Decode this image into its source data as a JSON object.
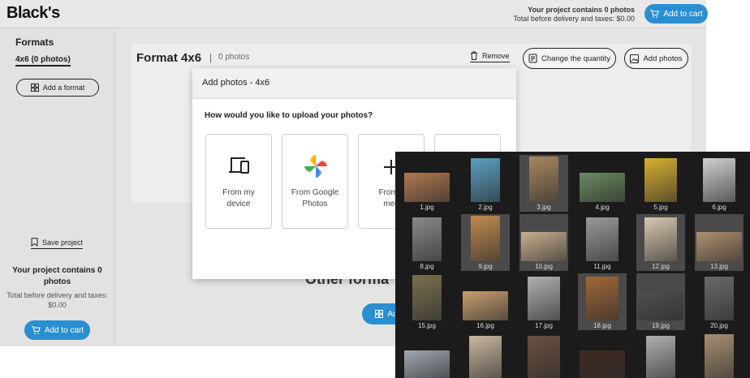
{
  "header": {
    "logo": "Black's",
    "project_summary": "Your project contains 0 photos",
    "total_note": "Total before delivery and taxes: $0.00",
    "add_to_cart": "Add to cart"
  },
  "sidebar": {
    "title": "Formats",
    "selected_format": "4x6 (0 photos)",
    "add_format": "Add a format",
    "save_project": "Save project",
    "summary_title": "Your project contains 0 photos",
    "summary_note": "Total before delivery and taxes: $0.00",
    "add_to_cart": "Add to cart"
  },
  "main": {
    "format_title": "Format 4x6",
    "separator": "|",
    "photo_count": "0 photos",
    "remove": "Remove",
    "change_quantity": "Change the quantity",
    "add_photos": "Add photos",
    "other_formats_heading": "Other forma",
    "add_button_partial": "Ad"
  },
  "modal": {
    "title": "Add photos - 4x6",
    "question": "How would you like to upload your photos?",
    "options": [
      {
        "line1": "From my",
        "line2": "device",
        "icon": "devices-icon"
      },
      {
        "line1": "From Google",
        "line2": "Photos",
        "icon": "google-photos-icon"
      },
      {
        "line1": "From s",
        "line2": "med",
        "icon": "plus-icon"
      }
    ]
  },
  "file_picker": {
    "files": [
      {
        "name": "1.jpg",
        "selected": false,
        "color": "#b07850"
      },
      {
        "name": "2.jpg",
        "selected": false,
        "color": "#5aa0c0"
      },
      {
        "name": "3.jpg",
        "selected": true,
        "color": "#a88860"
      },
      {
        "name": "4.jpg",
        "selected": false,
        "color": "#6a8a60"
      },
      {
        "name": "5.jpg",
        "selected": false,
        "color": "#d8b030"
      },
      {
        "name": "6.jpg",
        "selected": false,
        "color": "#d0d0d0"
      },
      {
        "name": "8.jpg",
        "selected": false,
        "color": "#8a8a8a"
      },
      {
        "name": "9.jpg",
        "selected": true,
        "color": "#c08a50"
      },
      {
        "name": "10.jpg",
        "selected": true,
        "color": "#c8b090"
      },
      {
        "name": "11.jpg",
        "selected": false,
        "color": "#9a9a9a"
      },
      {
        "name": "12.jpg",
        "selected": true,
        "color": "#d8c8b0"
      },
      {
        "name": "13.jpg",
        "selected": true,
        "color": "#b09070"
      },
      {
        "name": "15.jpg",
        "selected": false,
        "color": "#7a7050"
      },
      {
        "name": "16.jpg",
        "selected": false,
        "color": "#c8a070"
      },
      {
        "name": "17.jpg",
        "selected": false,
        "color": "#b0b0b0"
      },
      {
        "name": "18.jpg",
        "selected": true,
        "color": "#a06838"
      },
      {
        "name": "19.jpg",
        "selected": true,
        "color": "#505050"
      },
      {
        "name": "20.jpg",
        "selected": false,
        "color": "#6a6a6a"
      },
      {
        "name": "",
        "selected": false,
        "color": "#a0a8b0"
      },
      {
        "name": "",
        "selected": false,
        "color": "#c8b8a0"
      },
      {
        "name": "",
        "selected": false,
        "color": "#6a5040"
      },
      {
        "name": "",
        "selected": false,
        "color": "#402a20"
      },
      {
        "name": "",
        "selected": false,
        "color": "#b0b0b0"
      },
      {
        "name": "",
        "selected": false,
        "color": "#a89070"
      }
    ]
  },
  "colors": {
    "accent": "#2a8fd0",
    "picker_bg": "#1b1b1b"
  }
}
